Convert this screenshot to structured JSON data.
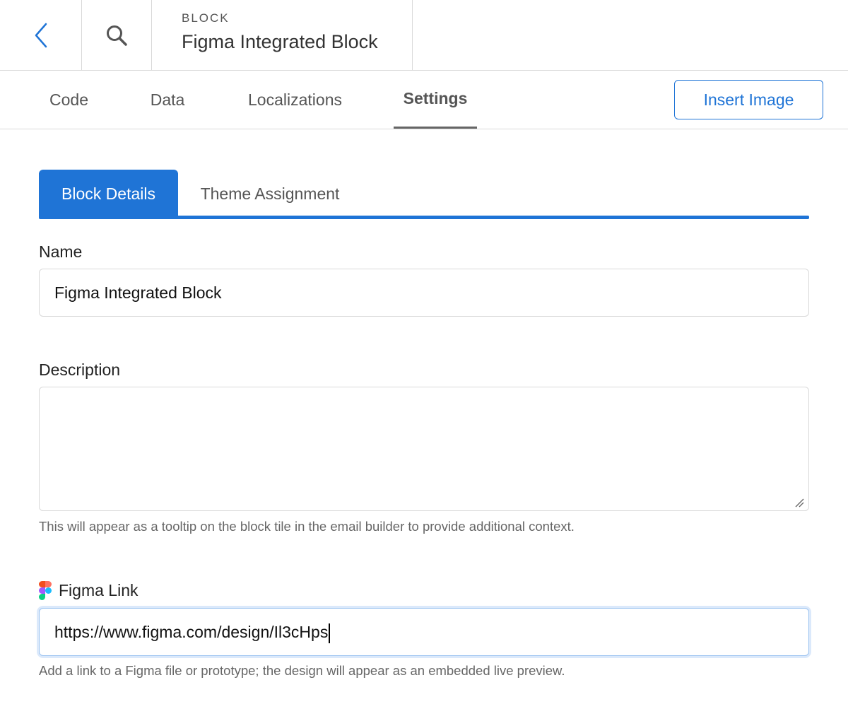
{
  "header": {
    "eyebrow": "BLOCK",
    "title": "Figma Integrated Block"
  },
  "tabs": [
    {
      "label": "Code",
      "active": false
    },
    {
      "label": "Data",
      "active": false
    },
    {
      "label": "Localizations",
      "active": false
    },
    {
      "label": "Settings",
      "active": true
    }
  ],
  "toolbar": {
    "insert_image_label": "Insert Image"
  },
  "subtabs": [
    {
      "label": "Block Details",
      "active": true
    },
    {
      "label": "Theme Assignment",
      "active": false
    }
  ],
  "form": {
    "name_label": "Name",
    "name_value": "Figma Integrated Block",
    "description_label": "Description",
    "description_value": "",
    "description_help": "This will appear as a tooltip on the block tile in the email builder to provide additional context.",
    "figma_label": "Figma Link",
    "figma_value": "https://www.figma.com/design/Il3cHps",
    "figma_help": "Add a link to a Figma file or prototype; the design will appear as an embedded live preview."
  },
  "colors": {
    "accent": "#1f74d6",
    "border": "#d9d9d9",
    "text_muted": "#666666"
  },
  "icons": [
    "chevron-left-icon",
    "search-icon",
    "figma-icon",
    "resize-grip-icon"
  ]
}
